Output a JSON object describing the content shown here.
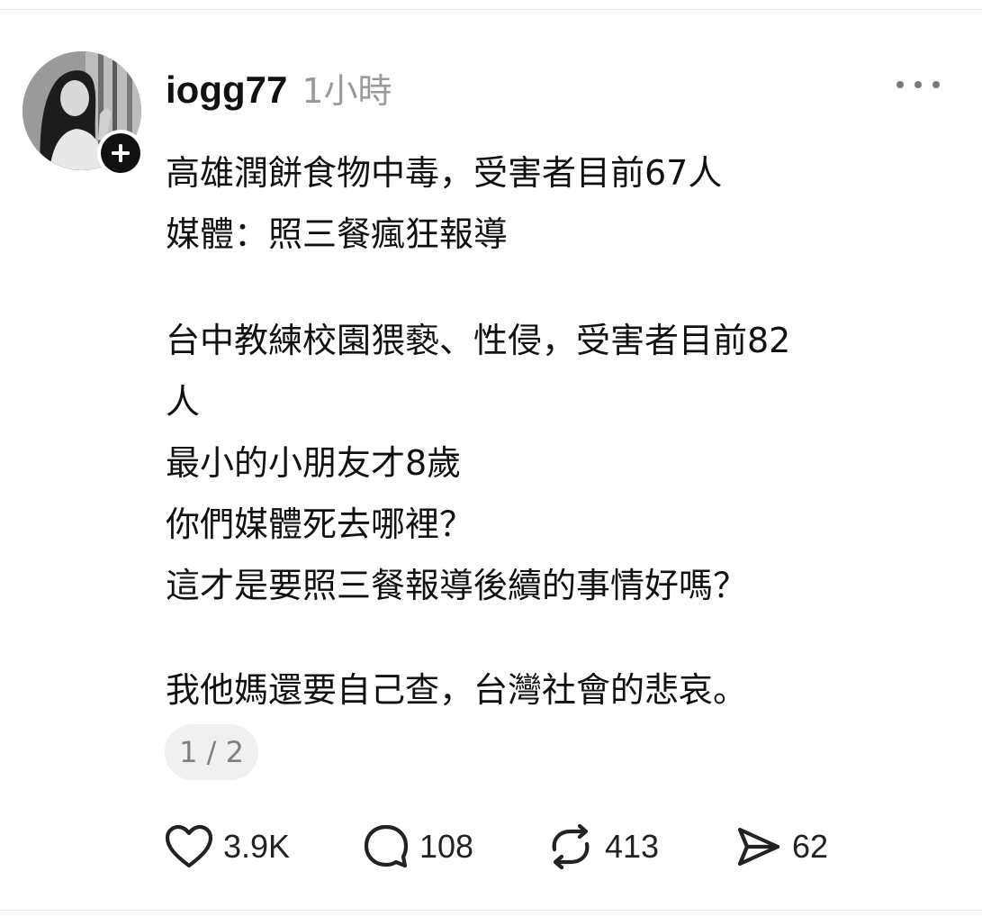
{
  "post": {
    "username": "iogg77",
    "timestamp": "1小時",
    "lines_block_1": [
      "高雄潤餅食物中毒，受害者目前67人",
      "媒體：照三餐瘋狂報導"
    ],
    "lines_block_2": [
      "台中教練校園猥褻、性侵，受害者目前82",
      "人",
      "最小的小朋友才8歲",
      "你們媒體死去哪裡？",
      "這才是要照三餐報導後續的事情好嗎？"
    ],
    "lines_block_3": [
      "我他媽還要自己查，台灣社會的悲哀。"
    ],
    "page_indicator": "1 / 2"
  },
  "actions": {
    "like_count": "3.9K",
    "comment_count": "108",
    "repost_count": "413",
    "share_count": "62"
  },
  "icons": {
    "like": "heart-icon",
    "comment": "comment-bubble-icon",
    "repost": "repost-icon",
    "share": "send-icon",
    "more": "more-dots-icon",
    "follow": "plus-icon"
  }
}
